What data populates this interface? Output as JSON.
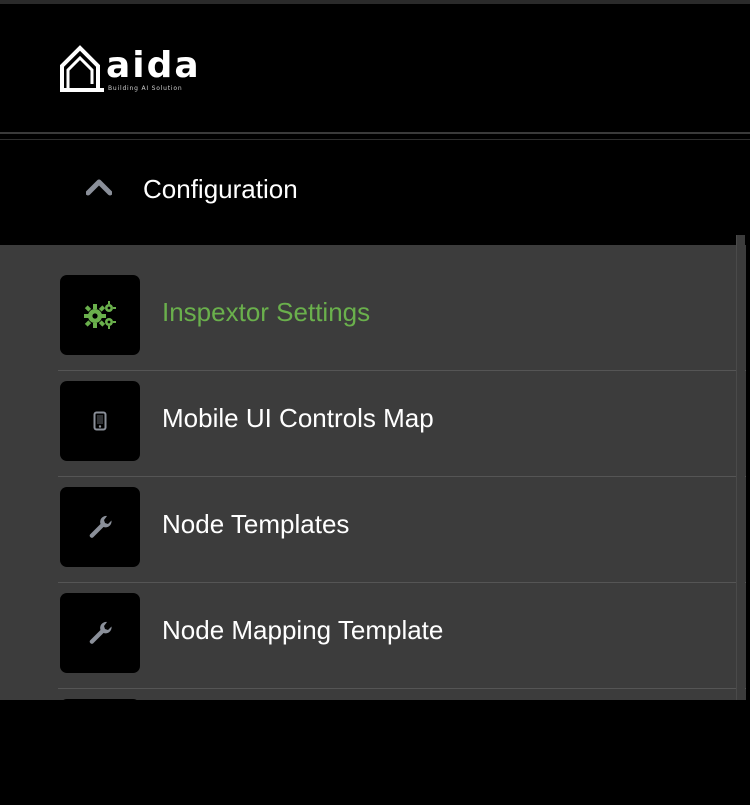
{
  "brand": {
    "wordmark": "aida",
    "tagline": "Building AI Solution"
  },
  "section": {
    "title": "Configuration",
    "expanded": true,
    "chevron_icon": "chevron-up-icon"
  },
  "menu": {
    "items": [
      {
        "label": "Inspextor Settings",
        "icon": "gears-icon",
        "active": true
      },
      {
        "label": "Mobile UI Controls Map",
        "icon": "mobile-phone-icon",
        "active": false
      },
      {
        "label": "Node Templates",
        "icon": "wrench-icon",
        "active": false
      },
      {
        "label": "Node Mapping Template",
        "icon": "wrench-icon",
        "active": false
      }
    ]
  },
  "colors": {
    "active": "#6ab04c",
    "list_background": "#3c3c3c",
    "icon_gray": "#8a8f99"
  }
}
